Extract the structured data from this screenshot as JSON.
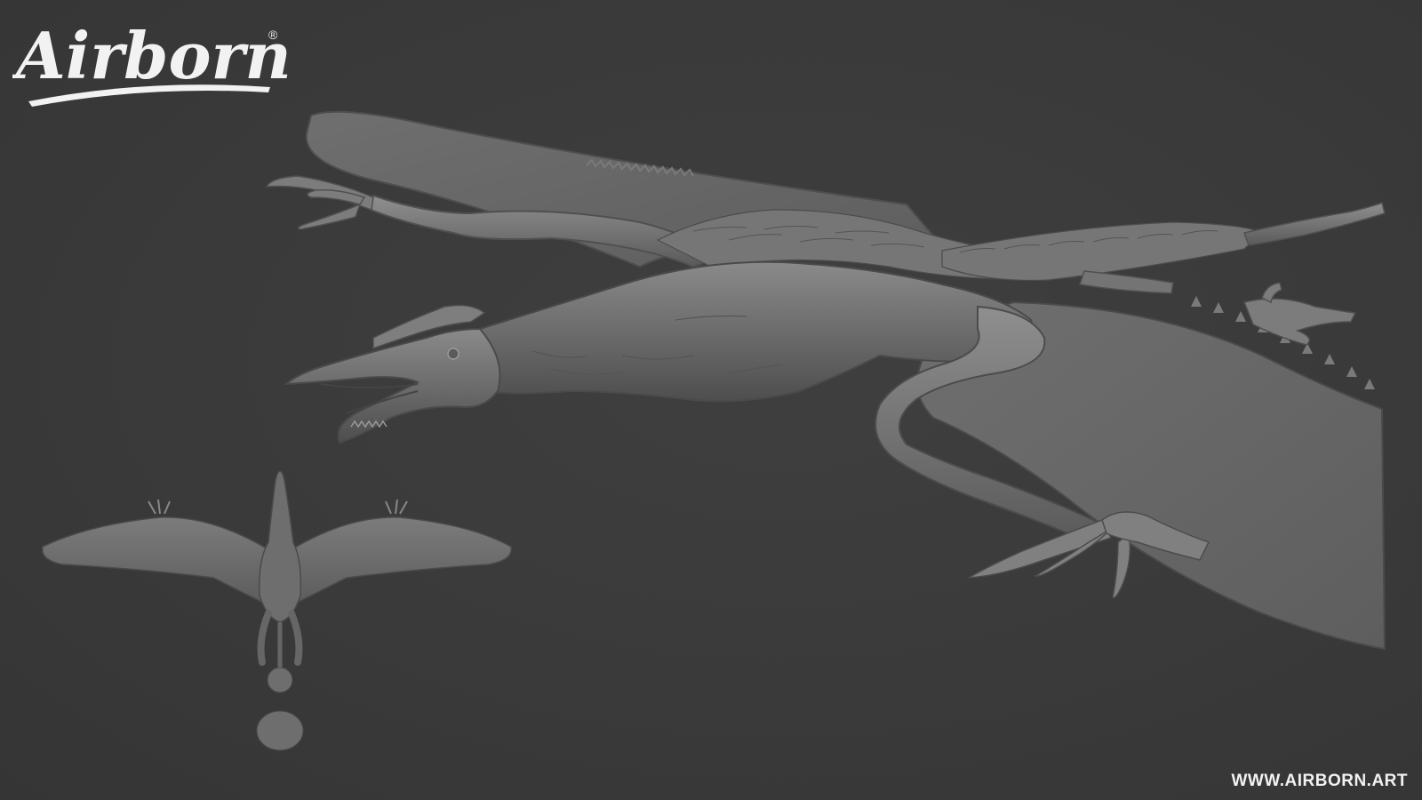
{
  "brand": {
    "logo_text": "Airborn",
    "registered_mark": "®"
  },
  "footer": {
    "url": "WWW.AIRBORN.ART"
  },
  "colors": {
    "background": "#3a3a3a",
    "sculpt_base": "#6e6e6e",
    "sculpt_shadow": "#4a4a4a",
    "sculpt_highlight": "#8c8c8c",
    "text": "#f2f2f2"
  },
  "scene": {
    "subject_icon": "pterosaur-sculpt",
    "secondary_icon": "pterosaur-top-view"
  }
}
